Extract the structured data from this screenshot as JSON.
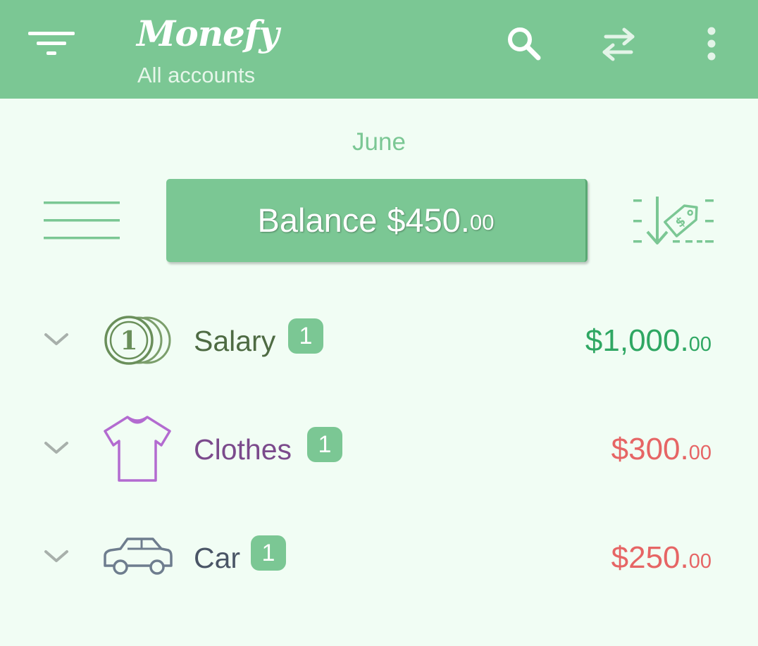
{
  "appbar": {
    "title": "Monefy",
    "subtitle": "All accounts",
    "menu_icon": "filter-menu-icon",
    "search_icon": "search-icon",
    "transfer_icon": "transfer-arrows-icon",
    "overflow_icon": "more-vert-icon",
    "background_color": "#7bc794"
  },
  "period": {
    "month": "June"
  },
  "balance": {
    "label": "Balance",
    "amount_main": "$450.",
    "amount_cents": "00",
    "list_icon": "list-lines-icon",
    "transfer_tag_icon": "price-tag-download-icon"
  },
  "categories": [
    {
      "name": "Salary",
      "count": "1",
      "amount_main": "$1,000.",
      "amount_cents": "00",
      "type": "income",
      "icon": "coins-icon",
      "name_color": "#4e6b43",
      "amount_color": "#2fa763"
    },
    {
      "name": "Clothes",
      "count": "1",
      "amount_main": "$300.",
      "amount_cents": "00",
      "type": "expense",
      "icon": "t-shirt-icon",
      "name_color": "#7b4a8c",
      "amount_color": "#e66565"
    },
    {
      "name": "Car",
      "count": "1",
      "amount_main": "$250.",
      "amount_cents": "00",
      "type": "expense",
      "icon": "car-icon",
      "name_color": "#4a5566",
      "amount_color": "#e66565"
    }
  ],
  "colors": {
    "accent": "#7bc794",
    "background": "#f1fdf4",
    "income": "#2fa763",
    "expense": "#e66565"
  }
}
